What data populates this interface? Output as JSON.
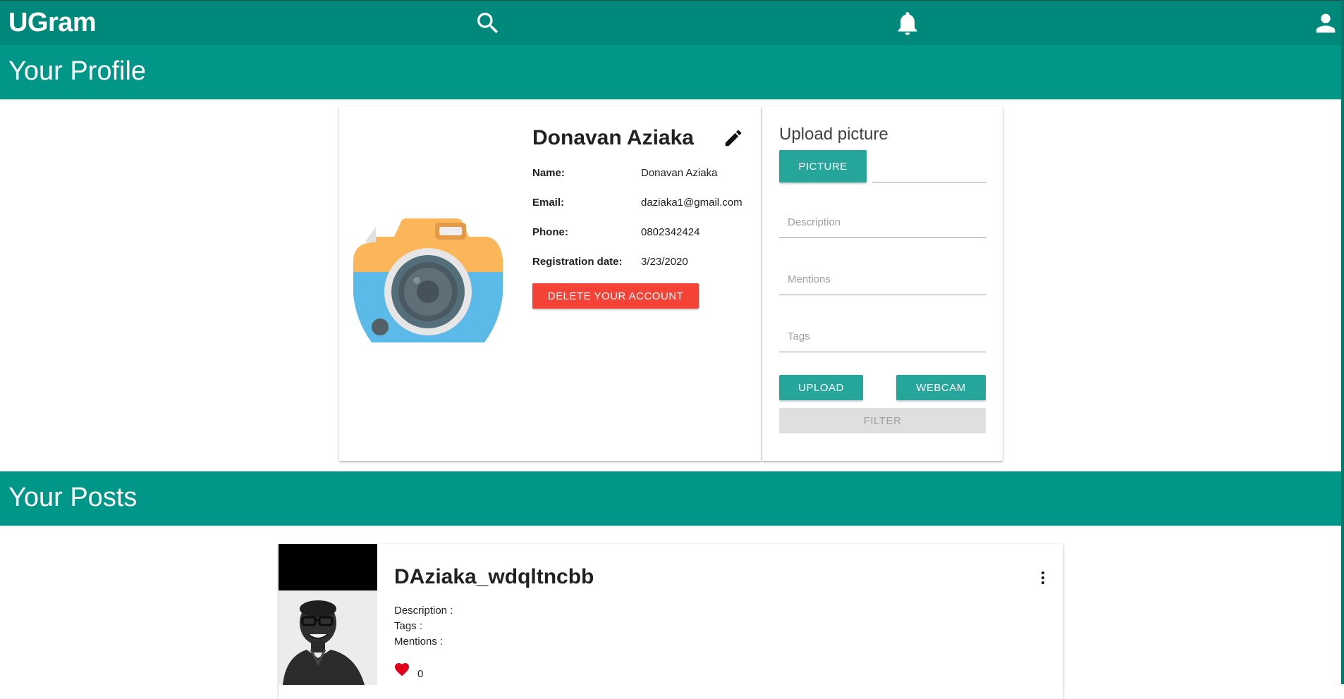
{
  "app": {
    "title": "UGram"
  },
  "header": {
    "search_icon": "search-icon",
    "notifications_icon": "bell-icon",
    "account_icon": "person-icon"
  },
  "profile_section": {
    "title": "Your Profile"
  },
  "profile": {
    "display_name": "Donavan Aziaka",
    "fields": [
      {
        "label": "Name:",
        "value": "Donavan Aziaka"
      },
      {
        "label": "Email:",
        "value": "daziaka1@gmail.com"
      },
      {
        "label": "Phone:",
        "value": "0802342424"
      },
      {
        "label": "Registration date:",
        "value": "3/23/2020"
      }
    ],
    "delete_label": "DELETE YOUR ACCOUNT"
  },
  "upload": {
    "title": "Upload picture",
    "picture_label": "PICTURE",
    "file_value": "",
    "description_placeholder": "Description",
    "mentions_placeholder": "Mentions",
    "tags_placeholder": "Tags",
    "upload_label": "UPLOAD",
    "webcam_label": "WEBCAM",
    "filter_label": "FILTER"
  },
  "posts_section": {
    "title": "Your Posts"
  },
  "posts": [
    {
      "author": "DAziaka_wdqltncbb",
      "description_label": "Description :",
      "tags_label": "Tags :",
      "mentions_label": "Mentions :",
      "likes": "0"
    }
  ],
  "colors": {
    "primary": "#00897b",
    "band": "#009688",
    "accent": "#26a69a",
    "danger": "#f44336",
    "like": "#e3001b"
  }
}
